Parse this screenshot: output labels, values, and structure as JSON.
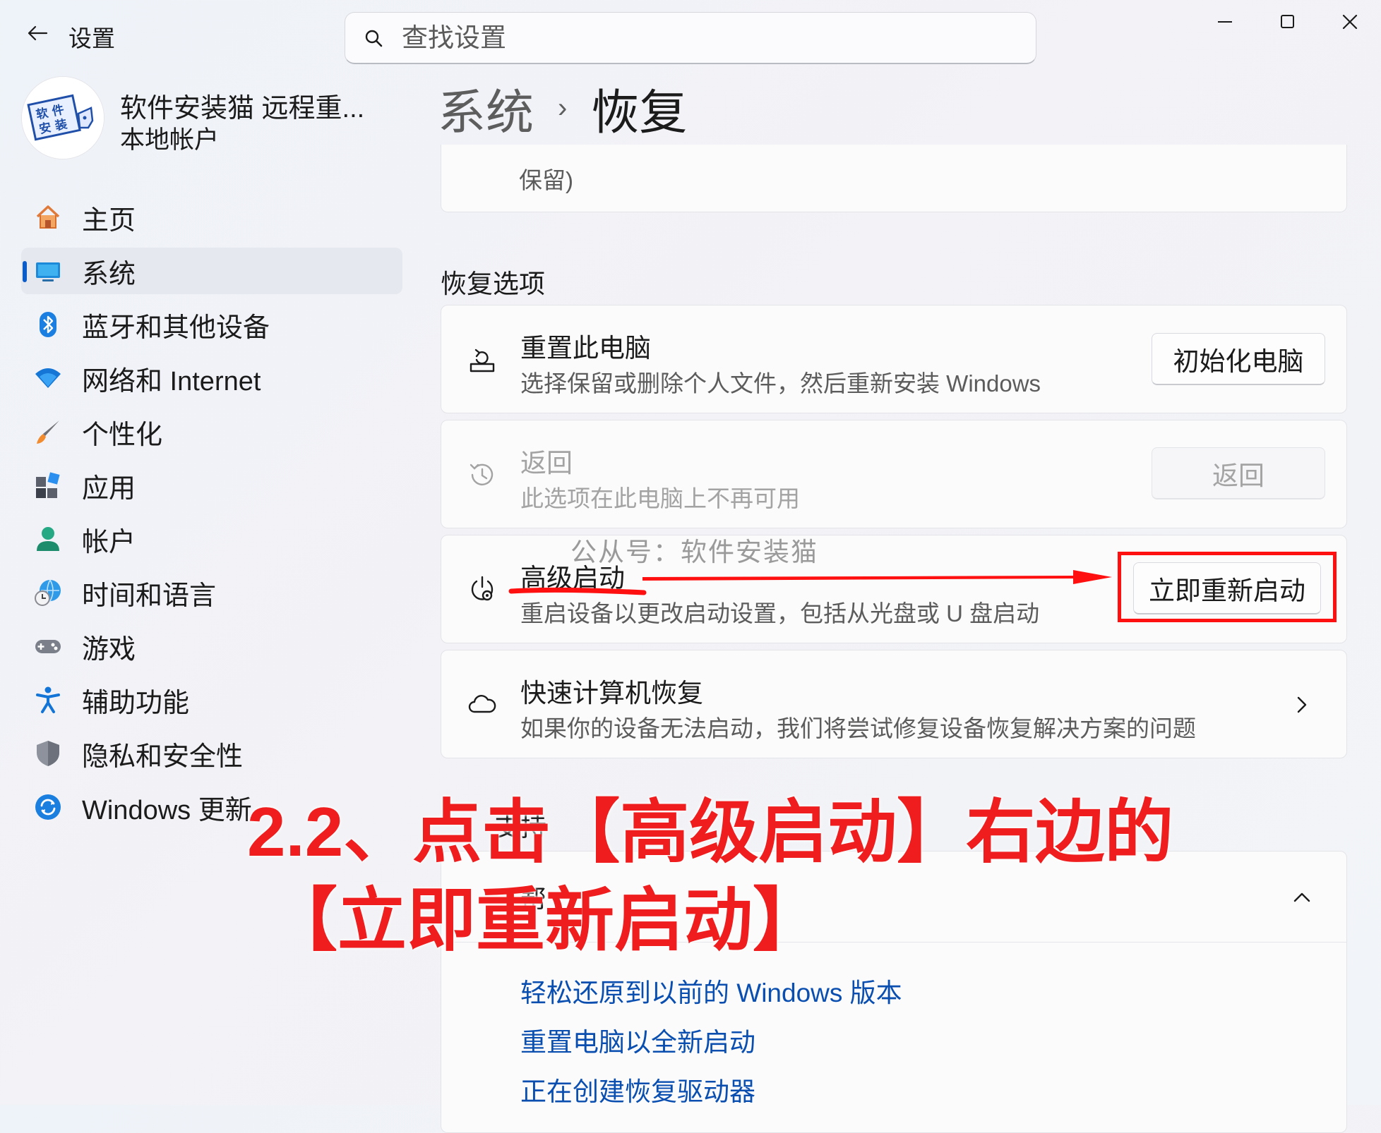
{
  "window": {
    "title": "设置",
    "search_placeholder": "查找设置"
  },
  "profile": {
    "name": "软件安装猫 远程重...",
    "account_type": "本地帐户",
    "avatar_text": [
      "软 件",
      "安 装"
    ]
  },
  "nav": {
    "items": [
      {
        "label": "主页",
        "icon": "home-icon"
      },
      {
        "label": "系统",
        "icon": "system-icon",
        "active": true
      },
      {
        "label": "蓝牙和其他设备",
        "icon": "bluetooth-icon"
      },
      {
        "label": "网络和 Internet",
        "icon": "wifi-icon"
      },
      {
        "label": "个性化",
        "icon": "brush-icon"
      },
      {
        "label": "应用",
        "icon": "apps-icon"
      },
      {
        "label": "帐户",
        "icon": "account-icon"
      },
      {
        "label": "时间和语言",
        "icon": "globe-clock-icon"
      },
      {
        "label": "游戏",
        "icon": "gamepad-icon"
      },
      {
        "label": "辅助功能",
        "icon": "accessibility-icon"
      },
      {
        "label": "隐私和安全性",
        "icon": "shield-icon"
      },
      {
        "label": "Windows 更新",
        "icon": "update-icon"
      }
    ]
  },
  "breadcrumb": {
    "parent": "系统",
    "separator": "›",
    "current": "恢复"
  },
  "previous_card": {
    "text_line2": "保留)"
  },
  "recovery_options": {
    "section_title": "恢复选项",
    "rows": [
      {
        "title": "重置此电脑",
        "description": "选择保留或删除个人文件，然后重新安装 Windows",
        "button": "初始化电脑",
        "icon": "reset-pc-icon",
        "enabled": true
      },
      {
        "title": "返回",
        "description": "此选项在此电脑上不再可用",
        "button": "返回",
        "icon": "history-icon",
        "enabled": false
      },
      {
        "title": "高级启动",
        "description": "重启设备以更改启动设置，包括从光盘或 U 盘启动",
        "button": "立即重新启动",
        "icon": "advanced-startup-icon",
        "enabled": true
      },
      {
        "title": "快速计算机恢复",
        "description": "如果你的设备无法启动，我们将尝试修复设备恢复解决方案的问题",
        "icon": "cloud-icon",
        "enabled": true
      }
    ]
  },
  "related": {
    "section_title_partial": "支持",
    "header_partial": "帮",
    "links": [
      "轻松还原到以前的 Windows 版本",
      "重置电脑以全新启动",
      "正在创建恢复驱动器"
    ]
  },
  "annotations": {
    "watermark": "公从号：软件安装猫",
    "callout_line1": "2.2、点击【高级启动】右边的",
    "callout_line2": "【立即重新启动】",
    "color": "#ef1d1d"
  }
}
